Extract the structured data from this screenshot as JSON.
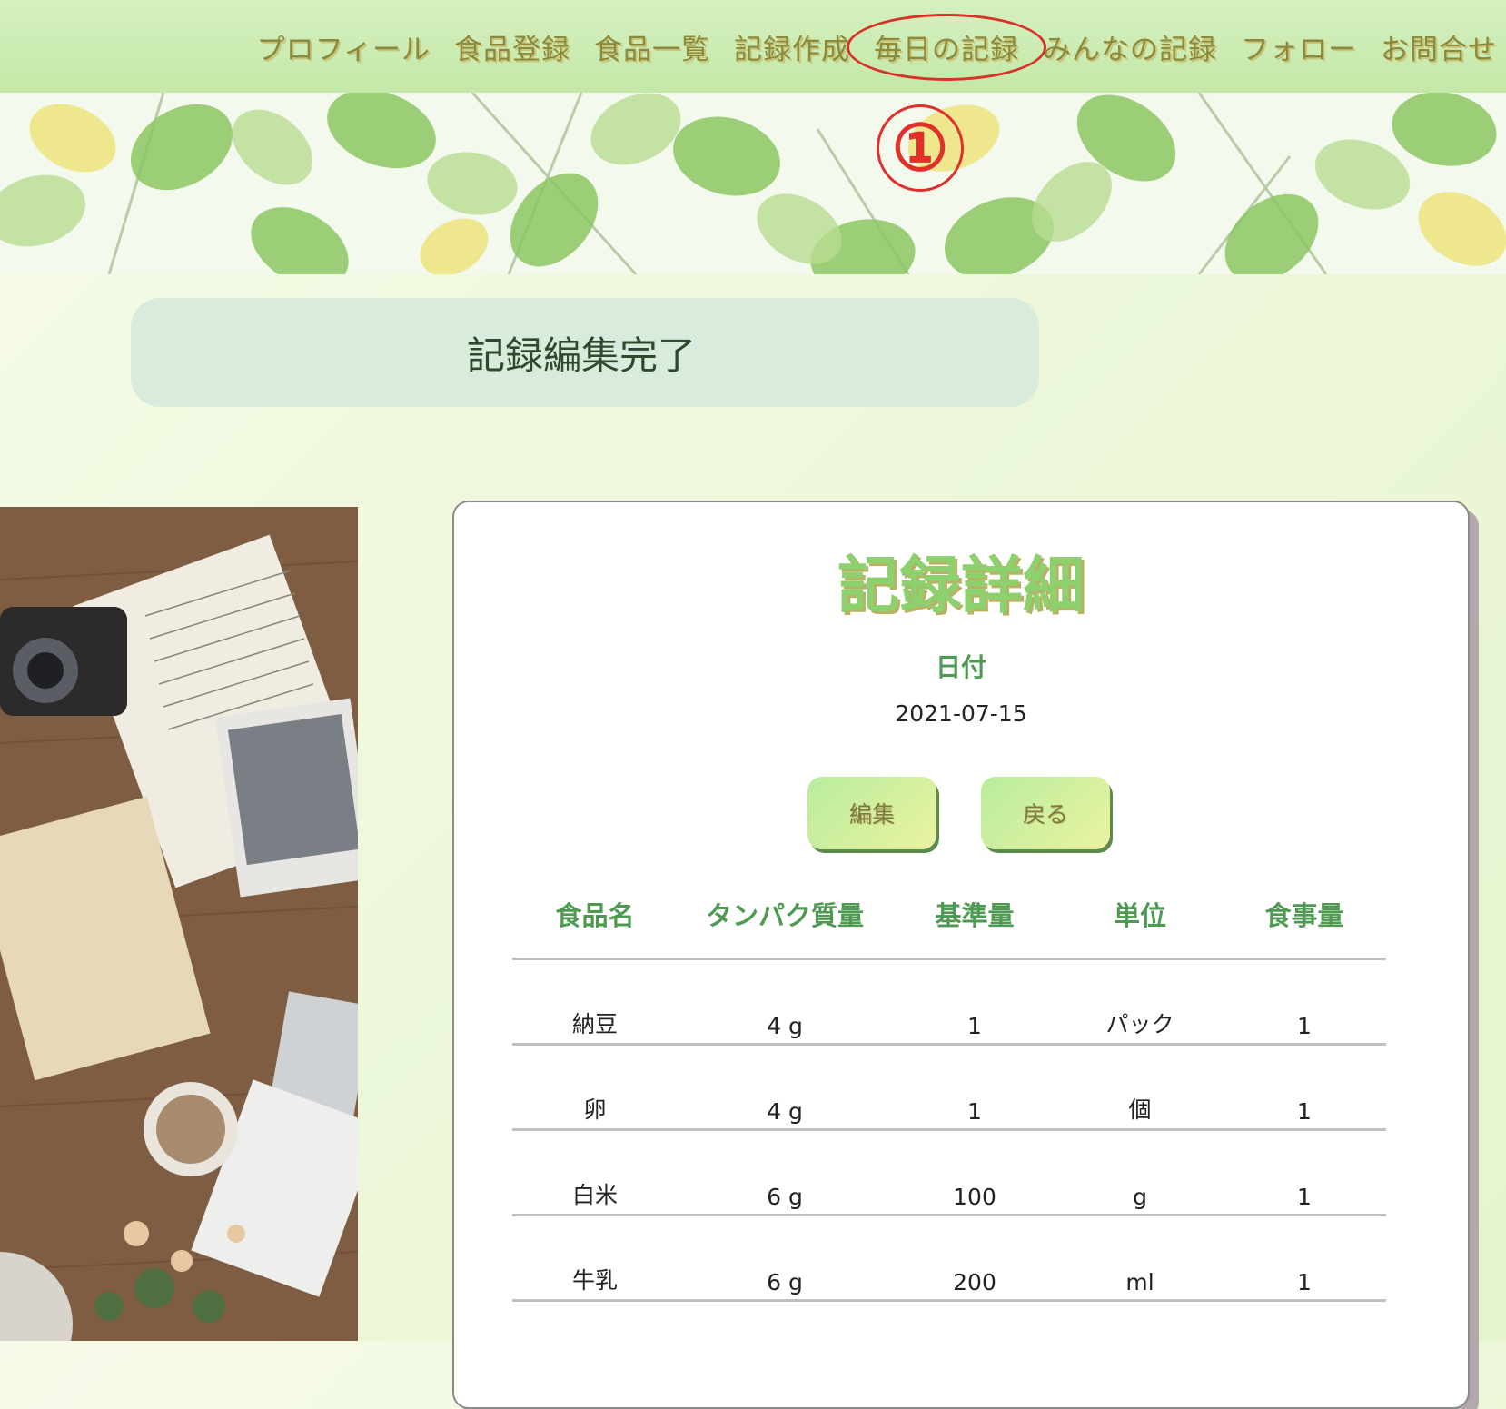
{
  "nav": {
    "items": [
      {
        "label": "プロフィール"
      },
      {
        "label": "食品登録"
      },
      {
        "label": "食品一覧"
      },
      {
        "label": "記録作成"
      },
      {
        "label": "毎日の記録"
      },
      {
        "label": "みんなの記録"
      },
      {
        "label": "フォロー"
      },
      {
        "label": "お問合せ"
      }
    ]
  },
  "annotation": {
    "marker": "①",
    "color": "#e0302a"
  },
  "flash": {
    "message": "記録編集完了"
  },
  "record": {
    "title": "記録詳細",
    "date_label": "日付",
    "date_value": "2021-07-15",
    "edit_label": "編集",
    "back_label": "戻る"
  },
  "table": {
    "headers": [
      "食品名",
      "タンパク質量",
      "基準量",
      "単位",
      "食事量"
    ],
    "rows": [
      [
        "納豆",
        "4 g",
        "1",
        "パック",
        "1"
      ],
      [
        "卵",
        "4 g",
        "1",
        "個",
        "1"
      ],
      [
        "白米",
        "6 g",
        "100",
        "g",
        "1"
      ],
      [
        "牛乳",
        "6 g",
        "200",
        "ml",
        "1"
      ]
    ]
  },
  "colors": {
    "accent_green": "#4f9a52",
    "title_green": "#8cd16e",
    "nav_bg": "#c3e8a8"
  }
}
